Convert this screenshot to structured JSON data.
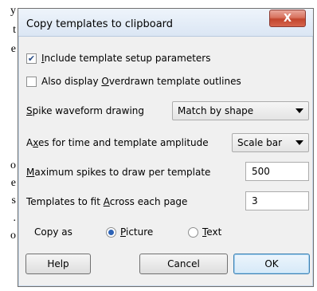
{
  "background_doc": {
    "lines_top": [
      "y",
      "t",
      "e"
    ],
    "lines_bottom": [
      "o",
      "e",
      "s",
      ".",
      "o"
    ]
  },
  "dialog": {
    "title": "Copy templates to clipboard",
    "close_glyph": "X",
    "include_setup": {
      "checked": true,
      "label_pre": "",
      "label_key": "I",
      "label_post": "nclude template setup parameters"
    },
    "overdrawn": {
      "checked": false,
      "label_pre": "Also display ",
      "label_key": "O",
      "label_post": "verdrawn template outlines"
    },
    "spike_drawing": {
      "label_key": "S",
      "label_post": "pike waveform drawing",
      "value": "Match by shape"
    },
    "axes": {
      "label_pre": "A",
      "label_key": "x",
      "label_post": "es for time and template amplitude",
      "value": "Scale bar"
    },
    "max_spikes": {
      "label_key": "M",
      "label_post": "aximum spikes to draw per template",
      "value": "500"
    },
    "fit_across": {
      "label_pre": "Templates to fit ",
      "label_key": "A",
      "label_post": "cross each page",
      "value": "3"
    },
    "copy_as": {
      "label": "Copy as",
      "picture": {
        "key": "P",
        "rest": "icture",
        "selected": true
      },
      "text": {
        "key": "T",
        "rest": "ext",
        "selected": false
      }
    },
    "buttons": {
      "help": "Help",
      "cancel": "Cancel",
      "ok": "OK"
    }
  }
}
